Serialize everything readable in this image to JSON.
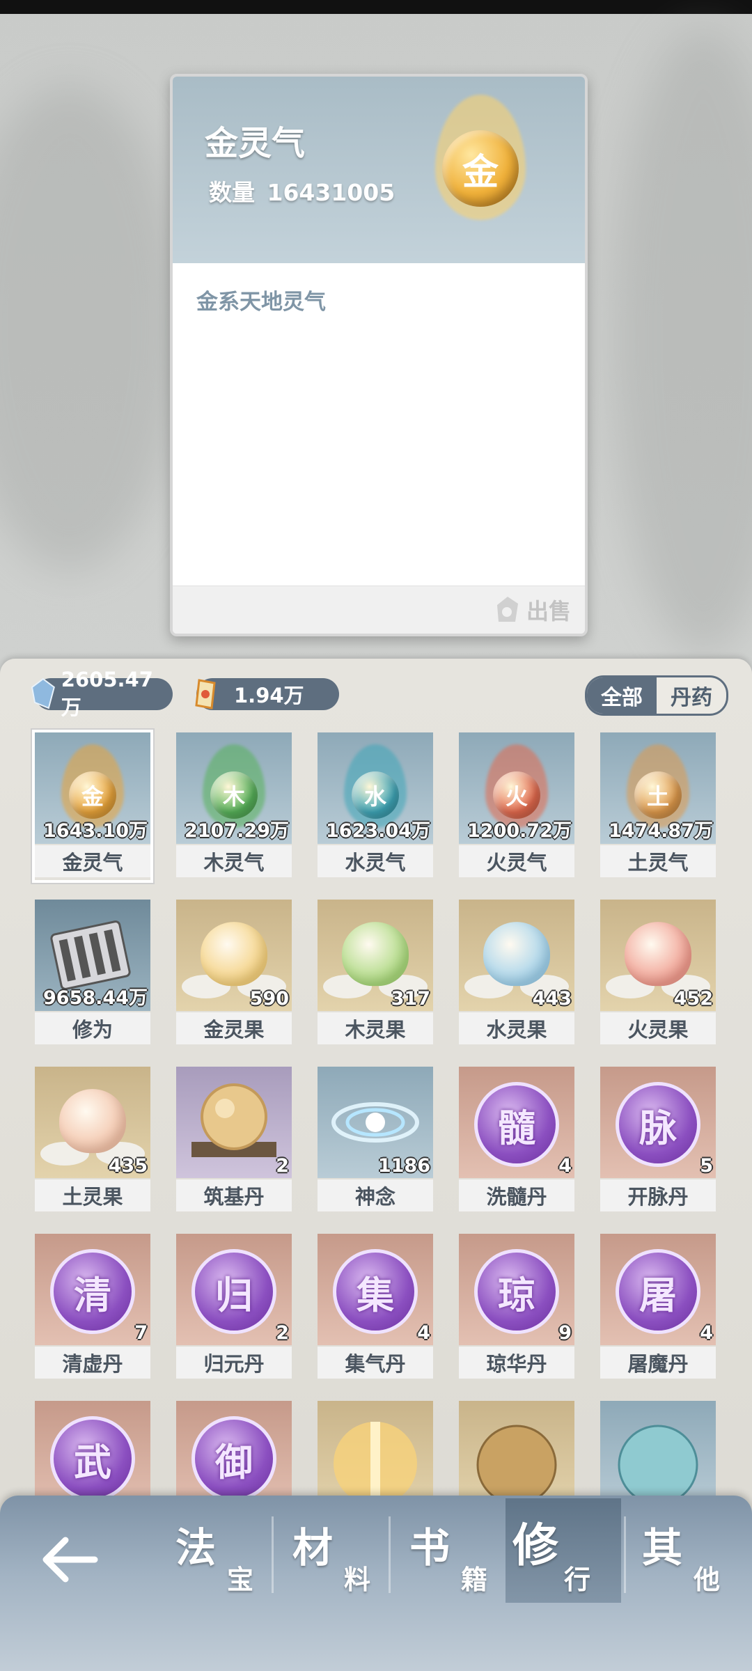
{
  "detail": {
    "name": "金灵气",
    "quantity_label": "数量",
    "quantity_value": "16431005",
    "description": "金系天地灵气",
    "sell_label": "出售",
    "orb_glyph": "金"
  },
  "currencies": [
    {
      "icon": "blue-crystal-icon",
      "value": "2605.47万"
    },
    {
      "icon": "talisman-icon",
      "value": "1.94万"
    }
  ],
  "filters": [
    {
      "label": "全部",
      "active": true
    },
    {
      "label": "丹药",
      "active": false
    }
  ],
  "items": [
    {
      "name": "金灵气",
      "count": "1643.10万",
      "kind": "qi",
      "glyph": "金",
      "color": "#e9a43a"
    },
    {
      "name": "木灵气",
      "count": "2107.29万",
      "kind": "qi",
      "glyph": "木",
      "color": "#57b25a"
    },
    {
      "name": "水灵气",
      "count": "1623.04万",
      "kind": "qi",
      "glyph": "水",
      "color": "#3fa6b8"
    },
    {
      "name": "火灵气",
      "count": "1200.72万",
      "kind": "qi",
      "glyph": "火",
      "color": "#e36a4e"
    },
    {
      "name": "土灵气",
      "count": "1474.87万",
      "kind": "qi",
      "glyph": "土",
      "color": "#df9a4c"
    },
    {
      "name": "修为",
      "count": "9658.44万",
      "kind": "scroll"
    },
    {
      "name": "金灵果",
      "count": "590",
      "kind": "fruit",
      "color": "#f3cf7c"
    },
    {
      "name": "木灵果",
      "count": "317",
      "kind": "fruit",
      "color": "#a8d77a"
    },
    {
      "name": "水灵果",
      "count": "443",
      "kind": "fruit",
      "color": "#9fd0ea"
    },
    {
      "name": "火灵果",
      "count": "452",
      "kind": "fruit",
      "color": "#ef9a8c"
    },
    {
      "name": "土灵果",
      "count": "435",
      "kind": "fruit",
      "color": "#f2c2a8"
    },
    {
      "name": "筑基丹",
      "count": "2",
      "kind": "foundation"
    },
    {
      "name": "神念",
      "count": "1186",
      "kind": "spirit"
    },
    {
      "name": "洗髓丹",
      "count": "4",
      "kind": "pill",
      "glyph": "髓"
    },
    {
      "name": "开脉丹",
      "count": "5",
      "kind": "pill",
      "glyph": "脉"
    },
    {
      "name": "清虚丹",
      "count": "7",
      "kind": "pill",
      "glyph": "清"
    },
    {
      "name": "归元丹",
      "count": "2",
      "kind": "pill",
      "glyph": "归"
    },
    {
      "name": "集气丹",
      "count": "4",
      "kind": "pill",
      "glyph": "集"
    },
    {
      "name": "琼华丹",
      "count": "9",
      "kind": "pill",
      "glyph": "琼"
    },
    {
      "name": "屠魔丹",
      "count": "4",
      "kind": "pill",
      "glyph": "屠"
    },
    {
      "name": "",
      "count": "",
      "kind": "pill",
      "glyph": "武"
    },
    {
      "name": "",
      "count": "",
      "kind": "pill",
      "glyph": "御"
    },
    {
      "name": "",
      "count": "",
      "kind": "golden"
    },
    {
      "name": "",
      "count": "",
      "kind": "brown-orb"
    },
    {
      "name": "",
      "count": "",
      "kind": "teal-orb"
    }
  ],
  "nav": {
    "back_icon": "back-arrow-icon",
    "tabs": [
      {
        "big": "法",
        "small": "宝",
        "active": false
      },
      {
        "big": "材",
        "small": "料",
        "active": false
      },
      {
        "big": "书",
        "small": "籍",
        "active": false
      },
      {
        "big": "修",
        "small": "行",
        "active": true
      },
      {
        "big": "其",
        "small": "他",
        "active": false
      }
    ]
  }
}
